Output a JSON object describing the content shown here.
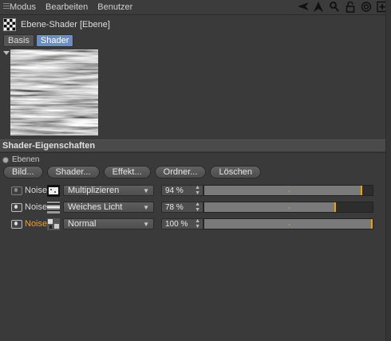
{
  "menu": {
    "items": [
      "Modus",
      "Bearbeiten",
      "Benutzer"
    ]
  },
  "toolbar_icons": [
    "arrow-left-icon",
    "arrow-up-icon",
    "search-icon",
    "lock-icon",
    "target-icon",
    "add-panel-icon"
  ],
  "object": {
    "title": "Ebene-Shader [Ebene]"
  },
  "tabs": [
    {
      "label": "Basis",
      "active": false
    },
    {
      "label": "Shader",
      "active": true
    }
  ],
  "section": {
    "title": "Shader-Eigenschaften",
    "radio_label": "Ebenen"
  },
  "buttons": {
    "bild": "Bild...",
    "shader": "Shader...",
    "effekt": "Effekt...",
    "ordner": "Ordner...",
    "loeschen": "Löschen"
  },
  "layers": [
    {
      "name": "Noise",
      "blend": "Multiplizieren",
      "value": "94 %",
      "fill": 0.94,
      "active": false,
      "visible_dim": true
    },
    {
      "name": "Noise",
      "blend": "Weiches Licht",
      "value": "78 %",
      "fill": 0.78,
      "active": false,
      "visible_dim": false
    },
    {
      "name": "Noise",
      "blend": "Normal",
      "value": "100 %",
      "fill": 1.0,
      "active": true,
      "visible_dim": false
    }
  ],
  "colors": {
    "accent": "#f0a000",
    "tab_active": "#6e8ec2",
    "background": "#3a3a3a"
  }
}
